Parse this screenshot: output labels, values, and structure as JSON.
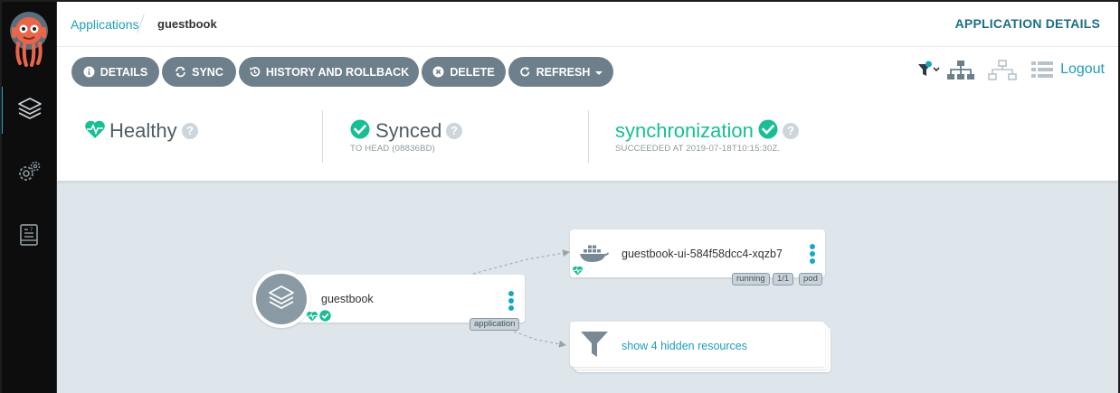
{
  "colors": {
    "accent": "#1f9eb8",
    "healthy": "#18be94",
    "button_bg": "#6d7f8b",
    "sidebar_bg": "#0d0d0d"
  },
  "breadcrumb": {
    "root": "Applications",
    "current": "guestbook"
  },
  "page_title": "APPLICATION DETAILS",
  "toolbar": {
    "details": "DETAILS",
    "sync": "SYNC",
    "history": "HISTORY AND ROLLBACK",
    "delete": "DELETE",
    "refresh": "REFRESH",
    "logout": "Logout"
  },
  "status": {
    "health": {
      "label": "Healthy",
      "help": "?"
    },
    "sync": {
      "label": "Synced",
      "help": "?",
      "sub": "TO HEAD (08836BD)"
    },
    "operation": {
      "label": "synchronization",
      "help": "?",
      "sub": "SUCCEEDED AT 2019-07-18T10:15:30Z."
    }
  },
  "sidebar": {
    "items": [
      {
        "name": "applications",
        "icon": "layers-icon",
        "active": true
      },
      {
        "name": "settings",
        "icon": "gear-icon",
        "active": false
      },
      {
        "name": "user-info",
        "icon": "book-icon",
        "active": false
      }
    ]
  },
  "graph": {
    "app_node": {
      "name": "guestbook",
      "kind": "application"
    },
    "pod_node": {
      "name": "guestbook-ui-584f58dcc4-xqzb7",
      "tags": [
        "running",
        "1/1",
        "pod"
      ]
    },
    "hidden_node": {
      "name": "show 4 hidden resources"
    }
  }
}
